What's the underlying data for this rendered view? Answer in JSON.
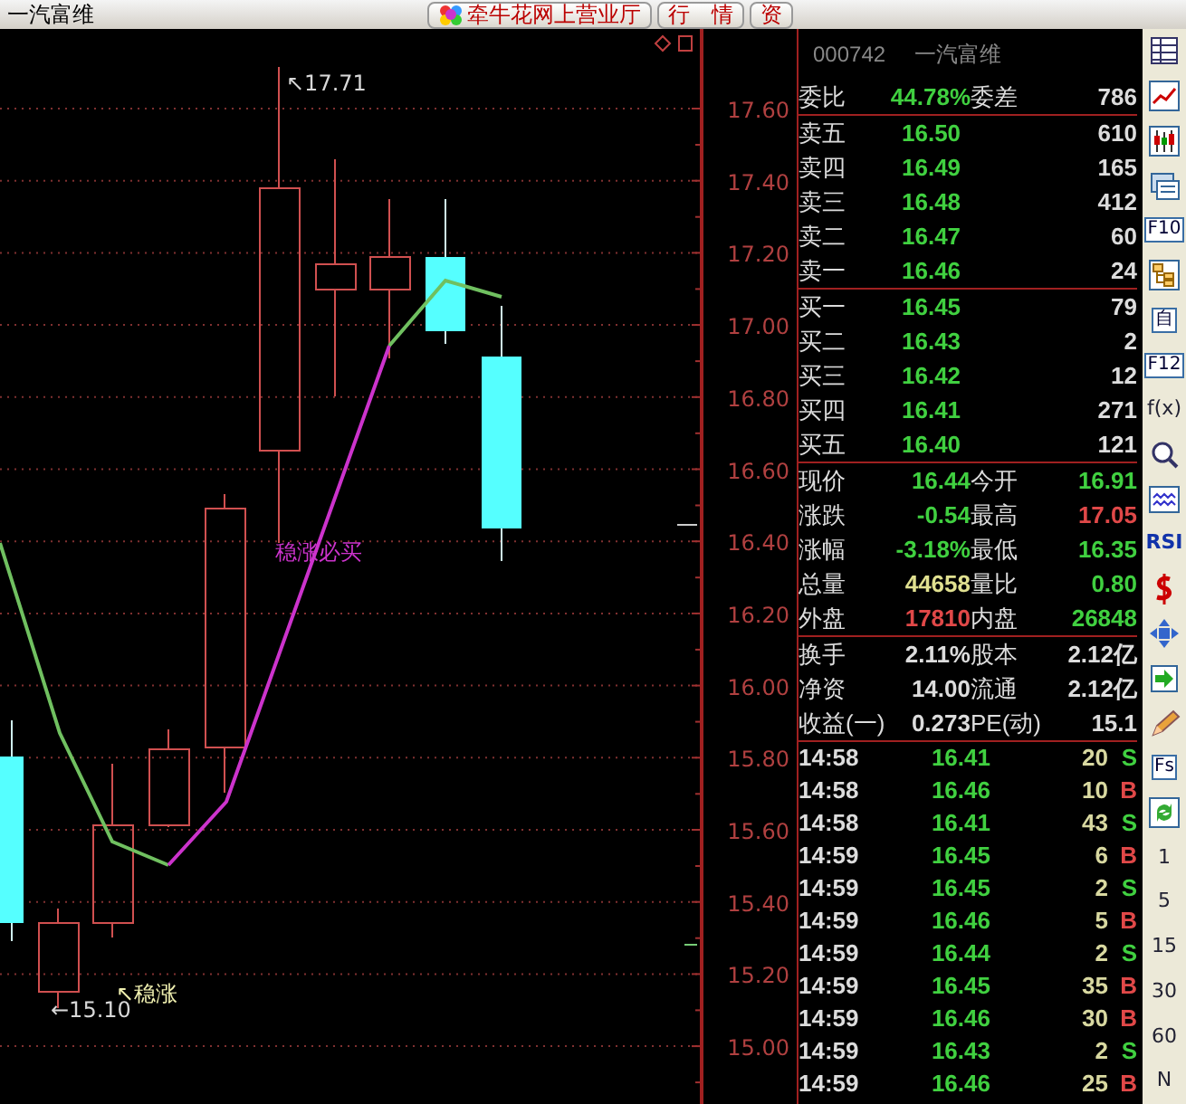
{
  "title_bar": {
    "title": "一汽富维",
    "buttons": [
      {
        "label": "牵牛花网上营业厅",
        "icon": true
      },
      {
        "label": "行　情",
        "icon": false
      },
      {
        "label": "资",
        "icon": false
      }
    ]
  },
  "chart": {
    "price_labels": [
      "17.60",
      "17.40",
      "17.20",
      "17.00",
      "16.80",
      "16.60",
      "16.40",
      "16.20",
      "16.00",
      "15.80",
      "15.60",
      "15.40",
      "15.20",
      "15.00"
    ],
    "annotations": [
      {
        "text": "↖17.71",
        "color": "#d8d8d8"
      },
      {
        "text": "稳涨必买",
        "color": "#cc33cc"
      },
      {
        "text": "↖稳涨",
        "color": "#f0f0b0"
      },
      {
        "text": "←15.10",
        "color": "#d8d8d8"
      }
    ]
  },
  "quote_panel": {
    "code": "000742",
    "name": "一汽富维",
    "sections": [
      {
        "kind": "quote",
        "rows": [
          {
            "items": [
              {
                "label": "委比",
                "value": "44.78%",
                "color": "#40d040"
              },
              {
                "label": "委差",
                "value": "786",
                "color": "#dcdcdc"
              }
            ]
          }
        ]
      },
      {
        "kind": "book",
        "rows": [
          {
            "label": "卖五",
            "price": "16.50",
            "volume": "610"
          },
          {
            "label": "卖四",
            "price": "16.49",
            "volume": "165"
          },
          {
            "label": "卖三",
            "price": "16.48",
            "volume": "412"
          },
          {
            "label": "卖二",
            "price": "16.47",
            "volume": "60"
          },
          {
            "label": "卖一",
            "price": "16.46",
            "volume": "24"
          }
        ]
      },
      {
        "kind": "book",
        "rows": [
          {
            "label": "买一",
            "price": "16.45",
            "volume": "79"
          },
          {
            "label": "买二",
            "price": "16.43",
            "volume": "2"
          },
          {
            "label": "买三",
            "price": "16.42",
            "volume": "12"
          },
          {
            "label": "买四",
            "price": "16.41",
            "volume": "271"
          },
          {
            "label": "买五",
            "price": "16.40",
            "volume": "121"
          }
        ]
      },
      {
        "kind": "quote",
        "rows": [
          {
            "items": [
              {
                "label": "现价",
                "value": "16.44",
                "color": "#40d040"
              },
              {
                "label": "今开",
                "value": "16.91",
                "color": "#40d040"
              }
            ]
          },
          {
            "items": [
              {
                "label": "涨跌",
                "value": "-0.54",
                "color": "#40d040"
              },
              {
                "label": "最高",
                "value": "17.05",
                "color": "#e04848"
              }
            ]
          },
          {
            "items": [
              {
                "label": "涨幅",
                "value": "-3.18%",
                "color": "#40d040"
              },
              {
                "label": "最低",
                "value": "16.35",
                "color": "#40d040"
              }
            ]
          },
          {
            "items": [
              {
                "label": "总量",
                "value": "44658",
                "color": "#e0e090"
              },
              {
                "label": "量比",
                "value": "0.80",
                "color": "#40d040"
              }
            ]
          },
          {
            "items": [
              {
                "label": "外盘",
                "value": "17810",
                "color": "#e04848"
              },
              {
                "label": "内盘",
                "value": "26848",
                "color": "#40d040"
              }
            ]
          }
        ]
      },
      {
        "kind": "quote",
        "rows": [
          {
            "items": [
              {
                "label": "换手",
                "value": "2.11%",
                "color": "#dcdcdc"
              },
              {
                "label": "股本",
                "value": "2.12亿",
                "color": "#dcdcdc"
              }
            ]
          },
          {
            "items": [
              {
                "label": "净资",
                "value": "14.00",
                "color": "#dcdcdc"
              },
              {
                "label": "流通",
                "value": "2.12亿",
                "color": "#dcdcdc"
              }
            ]
          },
          {
            "items": [
              {
                "label": "收益(一)",
                "value": "0.273",
                "color": "#dcdcdc"
              },
              {
                "label": "PE(动)",
                "value": "15.1",
                "color": "#dcdcdc"
              }
            ]
          }
        ]
      },
      {
        "kind": "trades",
        "rows": [
          {
            "time": "14:58",
            "price": "16.41",
            "volume": "20",
            "side": "S",
            "color": "#40d040"
          },
          {
            "time": "14:58",
            "price": "16.46",
            "volume": "10",
            "side": "B",
            "color": "#e04848"
          },
          {
            "time": "14:58",
            "price": "16.41",
            "volume": "43",
            "side": "S",
            "color": "#40d040"
          },
          {
            "time": "14:59",
            "price": "16.45",
            "volume": "6",
            "side": "B",
            "color": "#e04848"
          },
          {
            "time": "14:59",
            "price": "16.45",
            "volume": "2",
            "side": "S",
            "color": "#40d040"
          },
          {
            "time": "14:59",
            "price": "16.46",
            "volume": "5",
            "side": "B",
            "color": "#e04848"
          },
          {
            "time": "14:59",
            "price": "16.44",
            "volume": "2",
            "side": "S",
            "color": "#40d040"
          },
          {
            "time": "14:59",
            "price": "16.45",
            "volume": "35",
            "side": "B",
            "color": "#e04848"
          },
          {
            "time": "14:59",
            "price": "16.46",
            "volume": "30",
            "side": "B",
            "color": "#e04848"
          },
          {
            "time": "14:59",
            "price": "16.43",
            "volume": "2",
            "side": "S",
            "color": "#40d040"
          },
          {
            "time": "14:59",
            "price": "16.46",
            "volume": "25",
            "side": "B",
            "color": "#e04848"
          }
        ]
      }
    ]
  },
  "toolbar_labels": [
    "F10",
    "自",
    "F12",
    "f(x)",
    "RSI",
    "Fs",
    "1",
    "5",
    "15",
    "30",
    "60",
    "N"
  ]
}
